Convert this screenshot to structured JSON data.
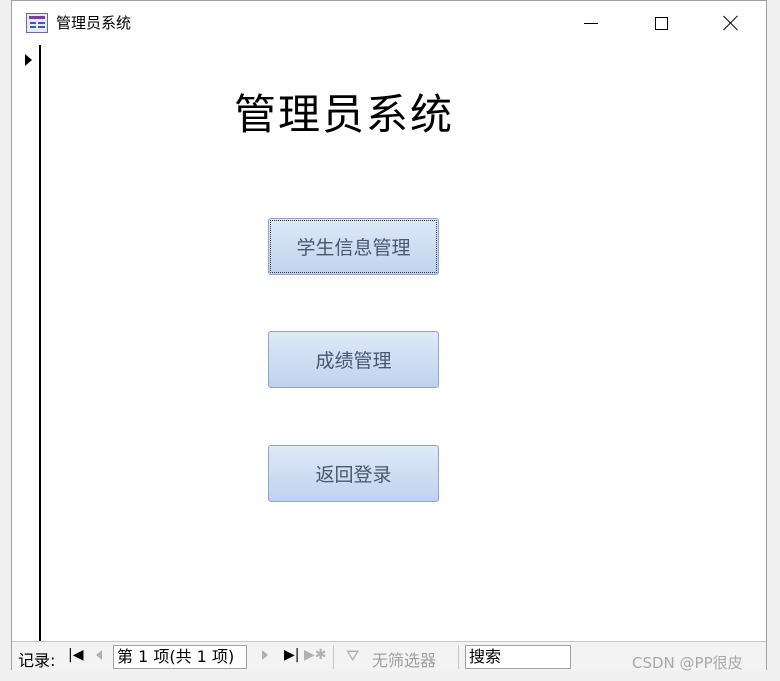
{
  "window": {
    "title": "管理员系统",
    "app_icon": "form-icon"
  },
  "form": {
    "heading": "管理员系统",
    "buttons": [
      {
        "label": "学生信息管理"
      },
      {
        "label": "成绩管理"
      },
      {
        "label": "返回登录"
      }
    ]
  },
  "navigation": {
    "record_label": "记录:",
    "current": "第 1 项(共 1 项)",
    "filter": "无筛选器",
    "search": "搜索"
  },
  "watermark": "CSDN @PP很皮",
  "colors": {
    "button_top": "#dfe9f8",
    "button_bottom": "#bfd2ee",
    "button_border": "#8aa6d0",
    "button_text": "#4a5670"
  }
}
